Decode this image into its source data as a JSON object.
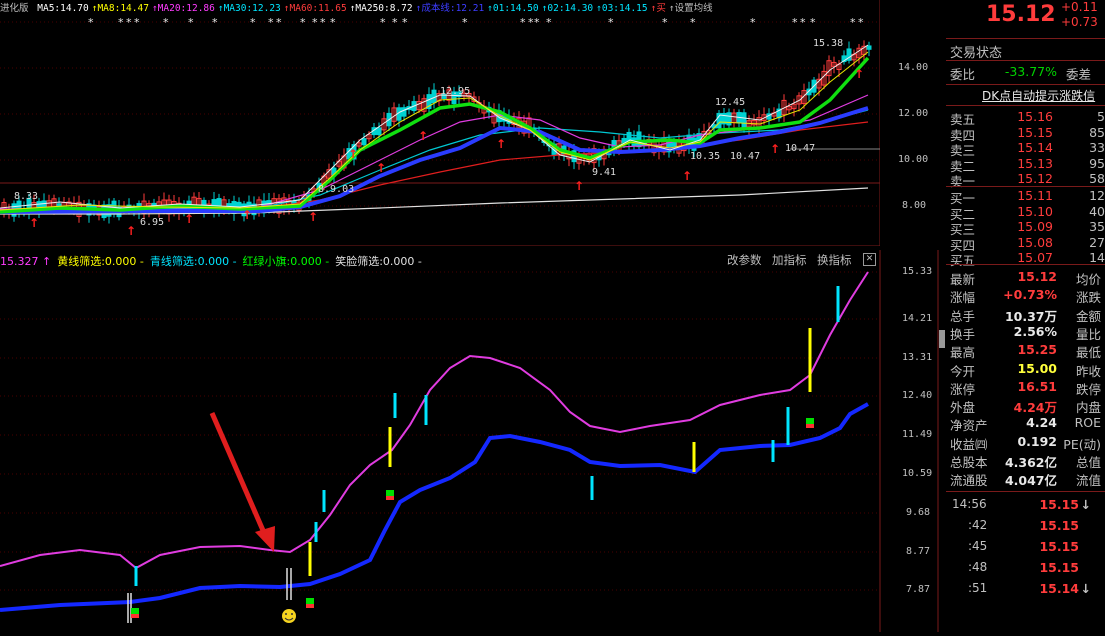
{
  "top_panel": {
    "title_fragment": "进化版",
    "ma_legend": [
      {
        "label": "MA5:14.70",
        "color": "#ffffff"
      },
      {
        "label": "MA8:14.47",
        "color": "#ffff00"
      },
      {
        "label": "MA20:12.86",
        "color": "#ff3cff"
      },
      {
        "label": "MA30:12.23",
        "color": "#00e5ff"
      },
      {
        "label": "MA60:11.65",
        "color": "#ff3c3c"
      },
      {
        "label": "MA250:8.72",
        "color": "#ffffff"
      },
      {
        "label": "成本线:12.21",
        "color": "#3c3cff"
      },
      {
        "label": "01:14.50",
        "color": "#00e5ff"
      },
      {
        "label": "02:14.30",
        "color": "#00e5ff"
      },
      {
        "label": "03:14.15",
        "color": "#00e5ff"
      },
      {
        "label": "买",
        "color": "#ff3c3c"
      },
      {
        "label": "设置均线",
        "color": "#bdbdbd"
      }
    ],
    "price_axis": [
      "14.00",
      "12.00",
      "10.00",
      "8.00"
    ],
    "annotations": [
      "8.33",
      "6.95",
      "8.9.03",
      "12.95",
      "12.45",
      "9.41",
      "10.35",
      "10.47",
      "10.47",
      "15.38"
    ]
  },
  "indicator_panel": {
    "legend": [
      {
        "label": "15.327",
        "color": "#ff3cff"
      },
      {
        "label": "黄线筛选:0.000",
        "color": "#ffff00"
      },
      {
        "label": "青线筛选:0.000",
        "color": "#00e5ff"
      },
      {
        "label": "红绿小旗:0.000",
        "color": "#00ff00"
      },
      {
        "label": "笑脸筛选:0.000",
        "color": "#e0e0e0"
      }
    ],
    "toolbar": {
      "edit_params": "改参数",
      "add_indicator": "加指标",
      "switch_indicator": "换指标",
      "close": "✕"
    },
    "axis": [
      "15.33",
      "14.21",
      "13.31",
      "12.40",
      "11.49",
      "10.59",
      "9.68",
      "8.77",
      "7.87"
    ]
  },
  "quote": {
    "price": "15.12",
    "change": "+0.11",
    "change_pct": "+0.73",
    "trade_status": "交易状态",
    "wei_bi_label": "委比",
    "wei_bi_value": "-33.77%",
    "wei_cha_label": "委差",
    "ticker_banner": "DK点自动提示涨跌信",
    "asks": [
      {
        "label": "卖五",
        "price": "15.16",
        "vol": "5"
      },
      {
        "label": "卖四",
        "price": "15.15",
        "vol": "85"
      },
      {
        "label": "卖三",
        "price": "15.14",
        "vol": "33"
      },
      {
        "label": "卖二",
        "price": "15.13",
        "vol": "95"
      },
      {
        "label": "卖一",
        "price": "15.12",
        "vol": "58"
      }
    ],
    "bids": [
      {
        "label": "买一",
        "price": "15.11",
        "vol": "12"
      },
      {
        "label": "买二",
        "price": "15.10",
        "vol": "40"
      },
      {
        "label": "买三",
        "price": "15.09",
        "vol": "35"
      },
      {
        "label": "买四",
        "price": "15.08",
        "vol": "27"
      },
      {
        "label": "买五",
        "price": "15.07",
        "vol": "14"
      }
    ],
    "stats": [
      {
        "label": "最新",
        "value": "15.12",
        "color": "#ff3c3c",
        "label2": "均价"
      },
      {
        "label": "涨幅",
        "value": "+0.73%",
        "color": "#ff3c3c",
        "label2": "涨跌"
      },
      {
        "label": "总手",
        "value": "10.37万",
        "color": "#e8e8e8",
        "label2": "金额"
      },
      {
        "label": "换手",
        "value": "2.56%",
        "color": "#e8e8e8",
        "label2": "量比"
      },
      {
        "label": "最高",
        "value": "15.25",
        "color": "#ff3c3c",
        "label2": "最低"
      },
      {
        "label": "今开",
        "value": "15.00",
        "color": "#ffff3c",
        "label2": "昨收"
      },
      {
        "label": "涨停",
        "value": "16.51",
        "color": "#ff3c3c",
        "label2": "跌停"
      },
      {
        "label": "外盘",
        "value": "4.24万",
        "color": "#ff3c3c",
        "label2": "内盘"
      },
      {
        "label": "净资产",
        "value": "4.24",
        "color": "#e8e8e8",
        "label2": "ROE"
      },
      {
        "label": "收益㈣",
        "value": "0.192",
        "color": "#e8e8e8",
        "label2": "PE(动)"
      },
      {
        "label": "总股本",
        "value": "4.362亿",
        "color": "#e8e8e8",
        "label2": "总值"
      },
      {
        "label": "流通股",
        "value": "4.047亿",
        "color": "#e8e8e8",
        "label2": "流值"
      }
    ],
    "ticks": [
      {
        "time": "14:56",
        "price": "15.15",
        "arrow": "↓"
      },
      {
        "time": ":42",
        "price": "15.15",
        "arrow": ""
      },
      {
        "time": ":45",
        "price": "15.15",
        "arrow": ""
      },
      {
        "time": ":48",
        "price": "15.15",
        "arrow": ""
      },
      {
        "time": ":51",
        "price": "15.14",
        "arrow": "↓"
      }
    ]
  }
}
